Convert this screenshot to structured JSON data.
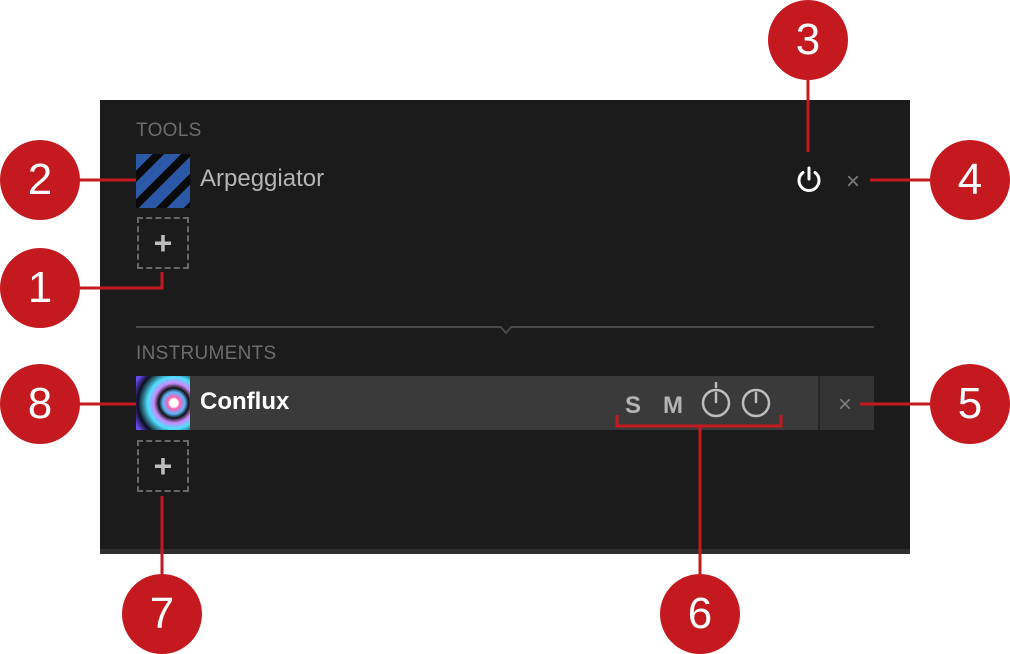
{
  "tools": {
    "section_label": "TOOLS",
    "items": [
      {
        "name": "Arpeggiator",
        "close": "×"
      }
    ],
    "add_label": "+"
  },
  "instruments": {
    "section_label": "INSTRUMENTS",
    "items": [
      {
        "name": "Conflux",
        "solo": "S",
        "mute": "M",
        "close": "×"
      }
    ],
    "add_label": "+"
  },
  "callouts": [
    "1",
    "2",
    "3",
    "4",
    "5",
    "6",
    "7",
    "8"
  ],
  "colors": {
    "panel": "#1b1b1b",
    "callout": "#c41a1f",
    "instrument_row": "#3a3a3a"
  },
  "icons": [
    "power-icon",
    "close-icon",
    "plus-icon",
    "output-knob-icon",
    "volume-knob-icon"
  ]
}
